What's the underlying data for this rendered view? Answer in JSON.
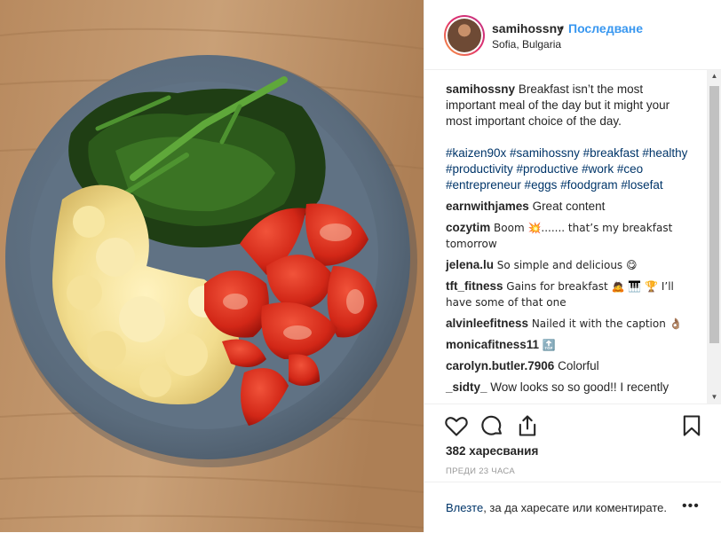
{
  "post": {
    "username": "samihossny",
    "separator": "•",
    "follow_label": "Последване",
    "location": "Sofia, Bulgaria",
    "caption_user": "samihossny",
    "caption_text": "Breakfast isn’t the most important meal of the day but it might your most important choice of the day.",
    "hashtags": "#kaizen90x #samihossny #breakfast #healthy #productivity #productive #work #ceo #entrepreneur #eggs #foodgram #losefat"
  },
  "comments": [
    {
      "user": "earnwithjames",
      "text": "Great content"
    },
    {
      "user": "cozytim",
      "text": "Boom 💥....... that’s my breakfast tomorrow"
    },
    {
      "user": "jelena.lu",
      "text": "So simple and delicious 😋"
    },
    {
      "user": "tft_fitness",
      "text": "Gains for breakfast 🙇 🎹 🏆 I’ll have some of that one"
    },
    {
      "user": "alvinleefitness",
      "text": "Nailed it with the caption 👌🏽"
    },
    {
      "user": "monicafitness11",
      "text": "🔝"
    },
    {
      "user": "carolyn.butler.7906",
      "text": "Colorful"
    },
    {
      "user": "_sidty_",
      "text": "Wow looks so so good!! I recently"
    }
  ],
  "actions": {
    "likes": "382 харесвания",
    "time": "ПРЕДИ 23 ЧАСА"
  },
  "footer": {
    "login_link": "Влезте",
    "login_text": ", за да харесате или коментирате.",
    "more": "•••"
  },
  "icons": {
    "like": "heart-icon",
    "comment": "comment-icon",
    "share": "share-icon",
    "save": "bookmark-icon"
  }
}
